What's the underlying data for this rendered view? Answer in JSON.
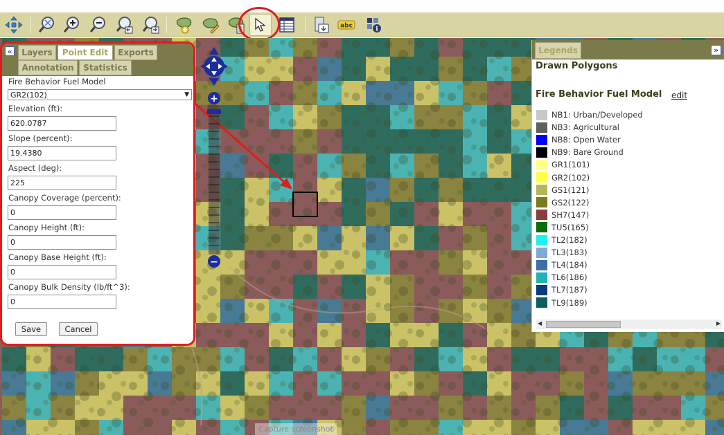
{
  "toolbar": {
    "icons": [
      "pan-arrows-icon",
      "zoom-extent-icon",
      "zoom-in-icon",
      "zoom-out-icon",
      "zoom-previous-icon",
      "zoom-next-icon",
      "draw-polygon-icon",
      "edit-polygon-icon",
      "polygon-document-icon",
      "select-arrow-icon",
      "table-icon",
      "export-icon",
      "label-icon",
      "identify-icon"
    ],
    "active_tool": "select-arrow-icon",
    "label_icon_text": "abc"
  },
  "left_panel": {
    "tabs": [
      "Layers",
      "Point Edit",
      "Exports",
      "Annotation",
      "Statistics"
    ],
    "active_tab": "Point Edit",
    "collapse_glyph": "«",
    "fields": {
      "fuel_model": {
        "label": "Fire Behavior Fuel Model",
        "value": "GR2(102)"
      },
      "elevation": {
        "label": "Elevation (ft):",
        "value": "620.0787"
      },
      "slope": {
        "label": "Slope (percent):",
        "value": "19.4380"
      },
      "aspect": {
        "label": "Aspect (deg):",
        "value": "225"
      },
      "canopy_coverage": {
        "label": "Canopy Coverage (percent):",
        "value": "0"
      },
      "canopy_height": {
        "label": "Canopy Height (ft):",
        "value": "0"
      },
      "canopy_base_height": {
        "label": "Canopy Base Height (ft):",
        "value": "0"
      },
      "canopy_bulk_density": {
        "label": "Canopy Bulk Density (lb/ft^3):",
        "value": "0"
      }
    },
    "save_label": "Save",
    "cancel_label": "Cancel"
  },
  "zoom": {
    "plus": "+",
    "minus": "−"
  },
  "legend": {
    "tab": "Legends",
    "expand_glyph": "»",
    "drawn_polygons": "Drawn Polygons",
    "fuel_model_title": "Fire Behavior Fuel Model",
    "edit_link": "edit",
    "items": [
      {
        "label": "NB1: Urban/Developed",
        "color": "#c8c8c8"
      },
      {
        "label": "NB3: Agricultural",
        "color": "#5f5f5f"
      },
      {
        "label": "NB8: Open Water",
        "color": "#0000ff"
      },
      {
        "label": "NB9: Bare Ground",
        "color": "#000000"
      },
      {
        "label": "GR1(101)",
        "color": "#ffff88"
      },
      {
        "label": "GR2(102)",
        "color": "#ffff44"
      },
      {
        "label": "GS1(121)",
        "color": "#b4b45a"
      },
      {
        "label": "GS2(122)",
        "color": "#7a7a1e"
      },
      {
        "label": "SH7(147)",
        "color": "#8b3c3c"
      },
      {
        "label": "TU5(165)",
        "color": "#0a6b0a"
      },
      {
        "label": "TL2(182)",
        "color": "#1ef0f0"
      },
      {
        "label": "TL3(183)",
        "color": "#7fa8d6"
      },
      {
        "label": "TL4(184)",
        "color": "#3d6fa6"
      },
      {
        "label": "TL6(186)",
        "color": "#20b3b3"
      },
      {
        "label": "TL7(187)",
        "color": "#0a3a80"
      },
      {
        "label": "TL9(189)",
        "color": "#0c5f5f"
      }
    ]
  },
  "map": {
    "capture_text": "Capture screenshot",
    "colors": {
      "brown": "#8a5a5a",
      "olive": "#8b8a3c",
      "yellow": "#d6d46a",
      "teal": "#1f6f5f",
      "cyan": "#3fc3c3",
      "blue": "#3c7fa0",
      "highlight": "#e01c1c"
    }
  }
}
